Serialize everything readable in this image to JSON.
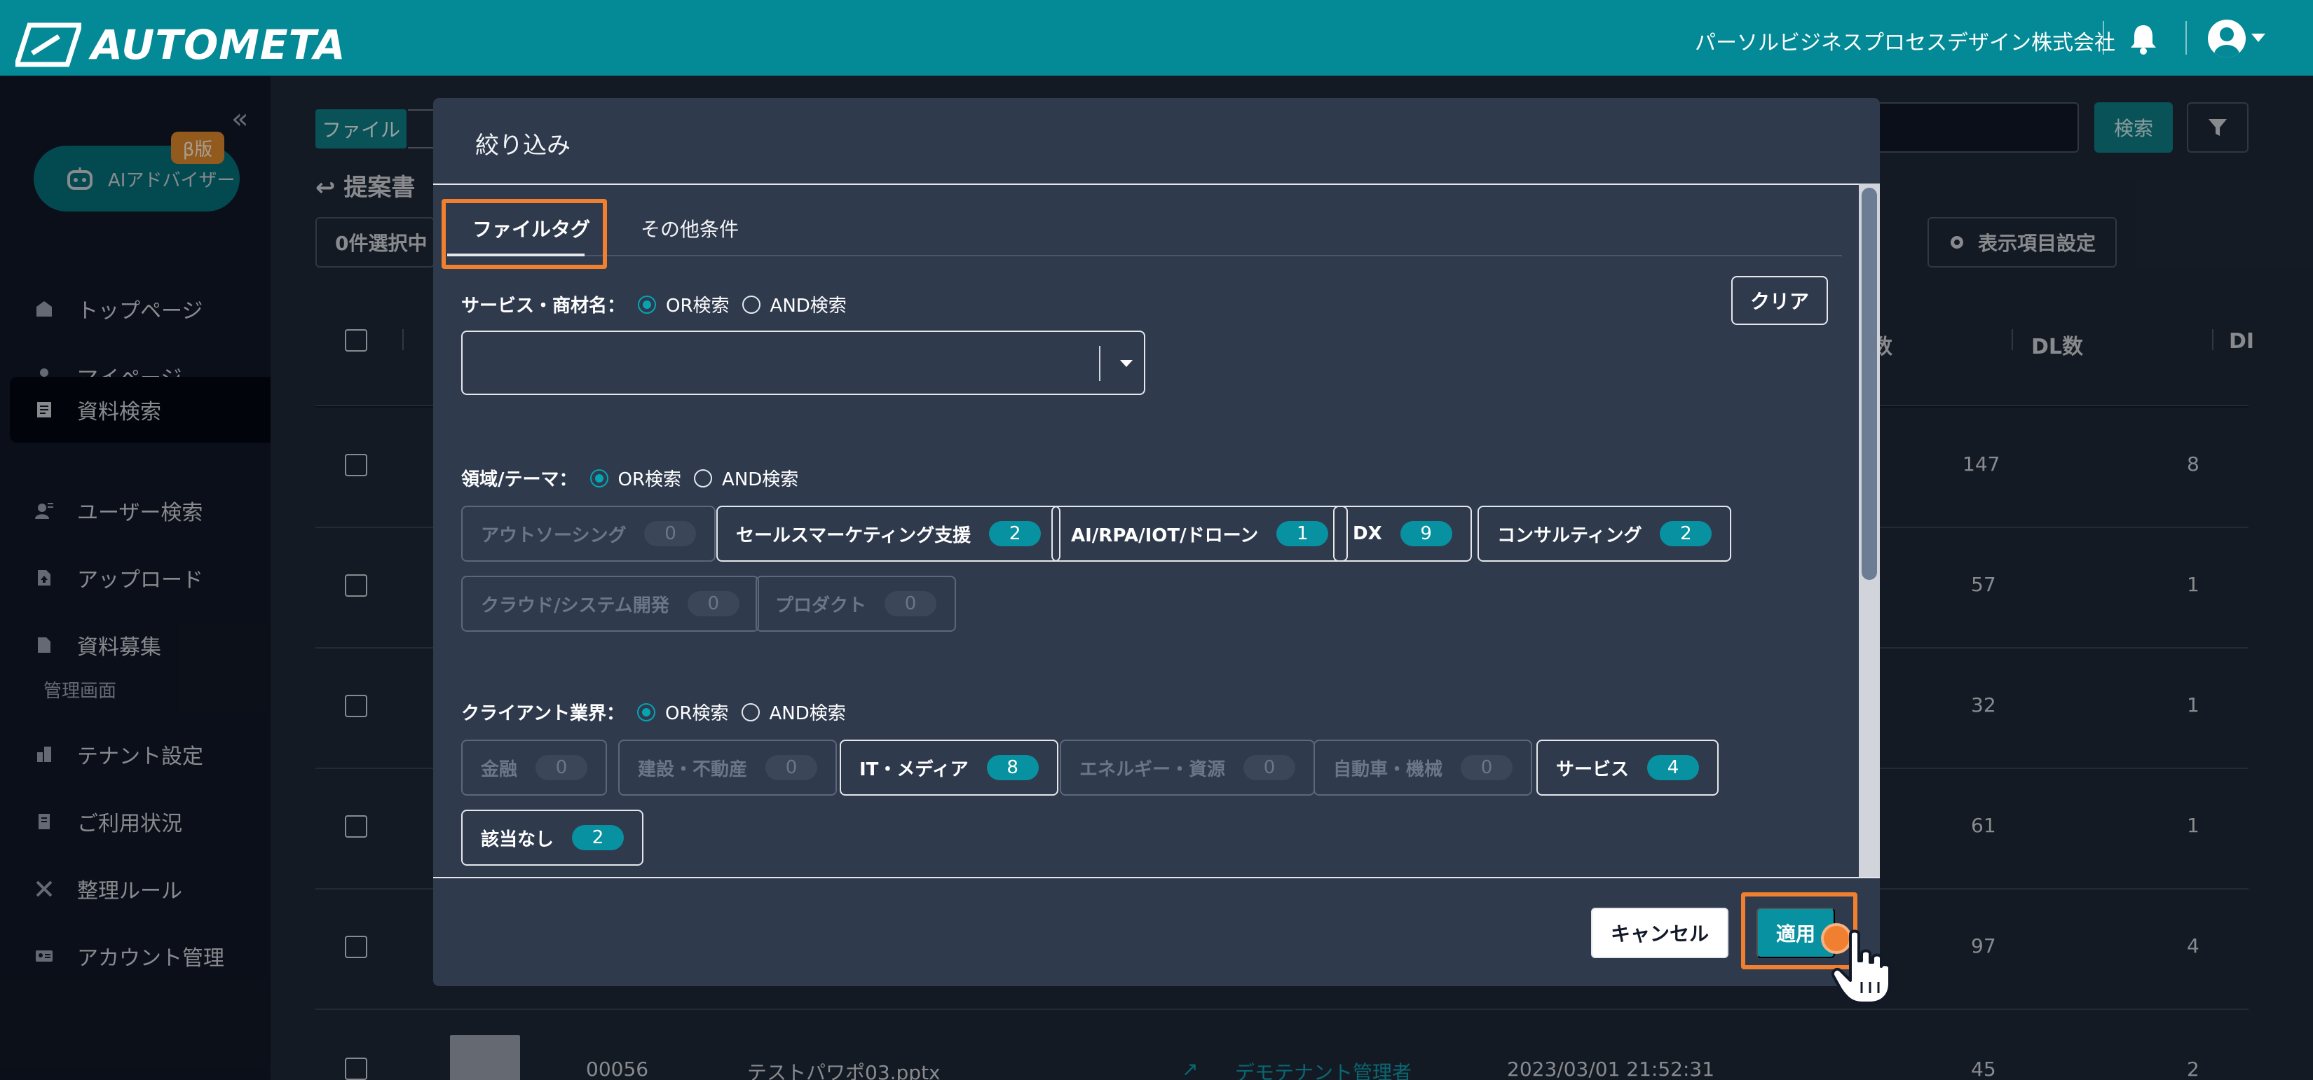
{
  "header": {
    "logo_text": "AUTOMETA",
    "company": "パーソルビジネスプロセスデザイン株式会社",
    "brand_color": "#038a96"
  },
  "sidebar": {
    "ai_advisor": "AIアドバイザー",
    "beta_badge": "β版",
    "items": [
      {
        "label": "トップページ",
        "icon": "home-icon"
      },
      {
        "label": "マイページ",
        "icon": "user-icon"
      },
      {
        "label": "資料検索",
        "icon": "document-search-icon",
        "active": true
      },
      {
        "label": "ユーザー検索",
        "icon": "user-search-icon"
      },
      {
        "label": "アップロード",
        "icon": "upload-icon"
      },
      {
        "label": "資料募集",
        "icon": "document-icon"
      }
    ],
    "admin_section": "管理画面",
    "admin_items": [
      {
        "label": "テナント設定",
        "icon": "building-icon"
      },
      {
        "label": "ご利用状況",
        "icon": "usage-icon"
      },
      {
        "label": "整理ルール",
        "icon": "tools-icon"
      },
      {
        "label": "アカウント管理",
        "icon": "id-card-icon"
      }
    ]
  },
  "background": {
    "file_tag": "ファイル",
    "search_button": "検索",
    "breadcrumb": "提案書",
    "selected_count": "0件選択中",
    "column_settings": "表示項目設定",
    "columns": {
      "count_partial": "数",
      "dl": "DL数",
      "dl_partial": "DI"
    },
    "rows": [
      {
        "a": "147",
        "b": "8"
      },
      {
        "a": "57",
        "b": "1"
      },
      {
        "a": "32",
        "b": "1"
      },
      {
        "a": "61",
        "b": "1"
      },
      {
        "a": "97",
        "b": "4"
      }
    ],
    "last_row": {
      "id": "00056",
      "name": "テストパワポ03.pptx",
      "owner": "デモテナント管理者",
      "date": "2023/03/01 21:52:31",
      "a": "45",
      "b": "2"
    }
  },
  "modal": {
    "title": "絞り込み",
    "tabs": [
      "ファイルタグ",
      "その他条件"
    ],
    "clear": "クリア",
    "or_label": "OR検索",
    "and_label": "AND検索",
    "service": {
      "label": "サービス・商材名："
    },
    "theme": {
      "label": "領域/テーマ：",
      "chips": [
        {
          "name": "アウトソーシング",
          "count": "0",
          "disabled": true
        },
        {
          "name": "セールスマーケティング支援",
          "count": "2",
          "disabled": false
        },
        {
          "name": "AI/RPA/IOT/ドローン",
          "count": "1",
          "disabled": false
        },
        {
          "name": "DX",
          "count": "9",
          "disabled": false
        },
        {
          "name": "コンサルティング",
          "count": "2",
          "disabled": false
        },
        {
          "name": "クラウド/システム開発",
          "count": "0",
          "disabled": true
        },
        {
          "name": "プロダクト",
          "count": "0",
          "disabled": true
        }
      ]
    },
    "industry": {
      "label": "クライアント業界：",
      "chips": [
        {
          "name": "金融",
          "count": "0",
          "disabled": true
        },
        {
          "name": "建設・不動産",
          "count": "0",
          "disabled": true
        },
        {
          "name": "IT・メディア",
          "count": "8",
          "disabled": false
        },
        {
          "name": "エネルギー・資源",
          "count": "0",
          "disabled": true
        },
        {
          "name": "自動車・機械",
          "count": "0",
          "disabled": true
        },
        {
          "name": "サービス",
          "count": "4",
          "disabled": false
        },
        {
          "name": "該当なし",
          "count": "2",
          "disabled": false
        }
      ]
    },
    "cancel": "キャンセル",
    "apply": "適用",
    "highlight_color": "#f07f2f"
  }
}
